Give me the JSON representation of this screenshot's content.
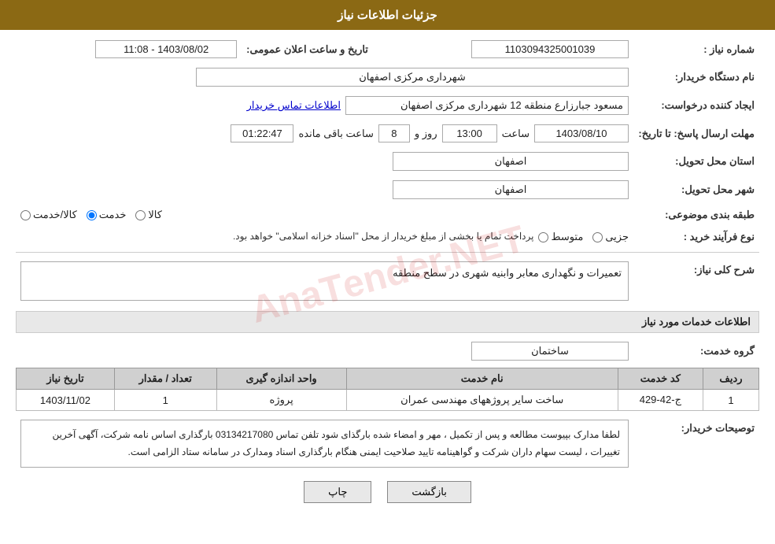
{
  "header": {
    "title": "جزئیات اطلاعات نیاز"
  },
  "fields": {
    "shomare_niaz_label": "شماره نیاز :",
    "shomare_niaz_value": "1103094325001039",
    "name_dastgah_label": "نام دستگاه خریدار:",
    "name_dastgah_value": "شهرداری مرکزی اصفهان",
    "creator_label": "ایجاد کننده درخواست:",
    "creator_value": "مسعود جبارزارع منطقه 12 شهرداری مرکزی اصفهان",
    "contact_link": "اطلاعات تماس خریدار",
    "mohlat_label": "مهلت ارسال پاسخ: تا تاریخ:",
    "date_value": "1403/08/10",
    "time_label": "ساعت",
    "time_value": "13:00",
    "day_label": "روز و",
    "day_value": "8",
    "remaining_label": "ساعت باقی مانده",
    "remaining_value": "01:22:47",
    "announce_label": "تاریخ و ساعت اعلان عمومی:",
    "announce_value": "1403/08/02 - 11:08",
    "ostan_label": "استان محل تحویل:",
    "ostan_value": "اصفهان",
    "shahr_label": "شهر محل تحویل:",
    "shahr_value": "اصفهان",
    "tabaqe_label": "طبقه بندی موضوعی:",
    "tabaqe_kala": "کالا",
    "tabaqe_khadamat": "خدمت",
    "tabaqe_kala_khadamat": "کالا/خدمت",
    "tabaqe_selected": "خدمت",
    "noe_farayand_label": "نوع فرآیند خرید :",
    "noe_jozee": "جزیی",
    "noe_mottasat": "متوسط",
    "noe_text": "پرداخت تمام یا بخشی از مبلغ خریدار از محل \"اسناد خزانه اسلامی\" خواهد بود.",
    "sharh_label": "شرح کلی نیاز:",
    "sharh_value": "تعمیرات و نگهداری معابر وابنیه شهری در سطح منطقه",
    "services_section": "اطلاعات خدمات مورد نیاز",
    "group_label": "گروه خدمت:",
    "group_value": "ساختمان",
    "table_headers": {
      "radif": "ردیف",
      "kod": "کد خدمت",
      "nam": "نام خدمت",
      "vahed": "واحد اندازه گیری",
      "tedad": "تعداد / مقدار",
      "tarikh": "تاریخ نیاز"
    },
    "table_rows": [
      {
        "radif": "1",
        "kod": "ج-42-429",
        "nam": "ساخت سایر پروژههای مهندسی عمران",
        "vahed": "پروژه",
        "tedad": "1",
        "tarikh": "1403/11/02"
      }
    ],
    "buyer_desc_label": "توصیحات خریدار:",
    "buyer_desc": "لطفا مدارک بپیوست مطالعه و پس از تکمیل ، مهر و امضاء شده بارگذای شود تلفن تماس 03134217080 بارگذاری اساس نامه شرکت، آگهی آخرین تغییرات ، لیست سهام داران شرکت و گواهینامه تایید صلاحیت ایمنی هنگام بارگذاری اسناد ومدارک در سامانه ستاد الزامی است.",
    "btn_print": "چاپ",
    "btn_back": "بازگشت"
  }
}
